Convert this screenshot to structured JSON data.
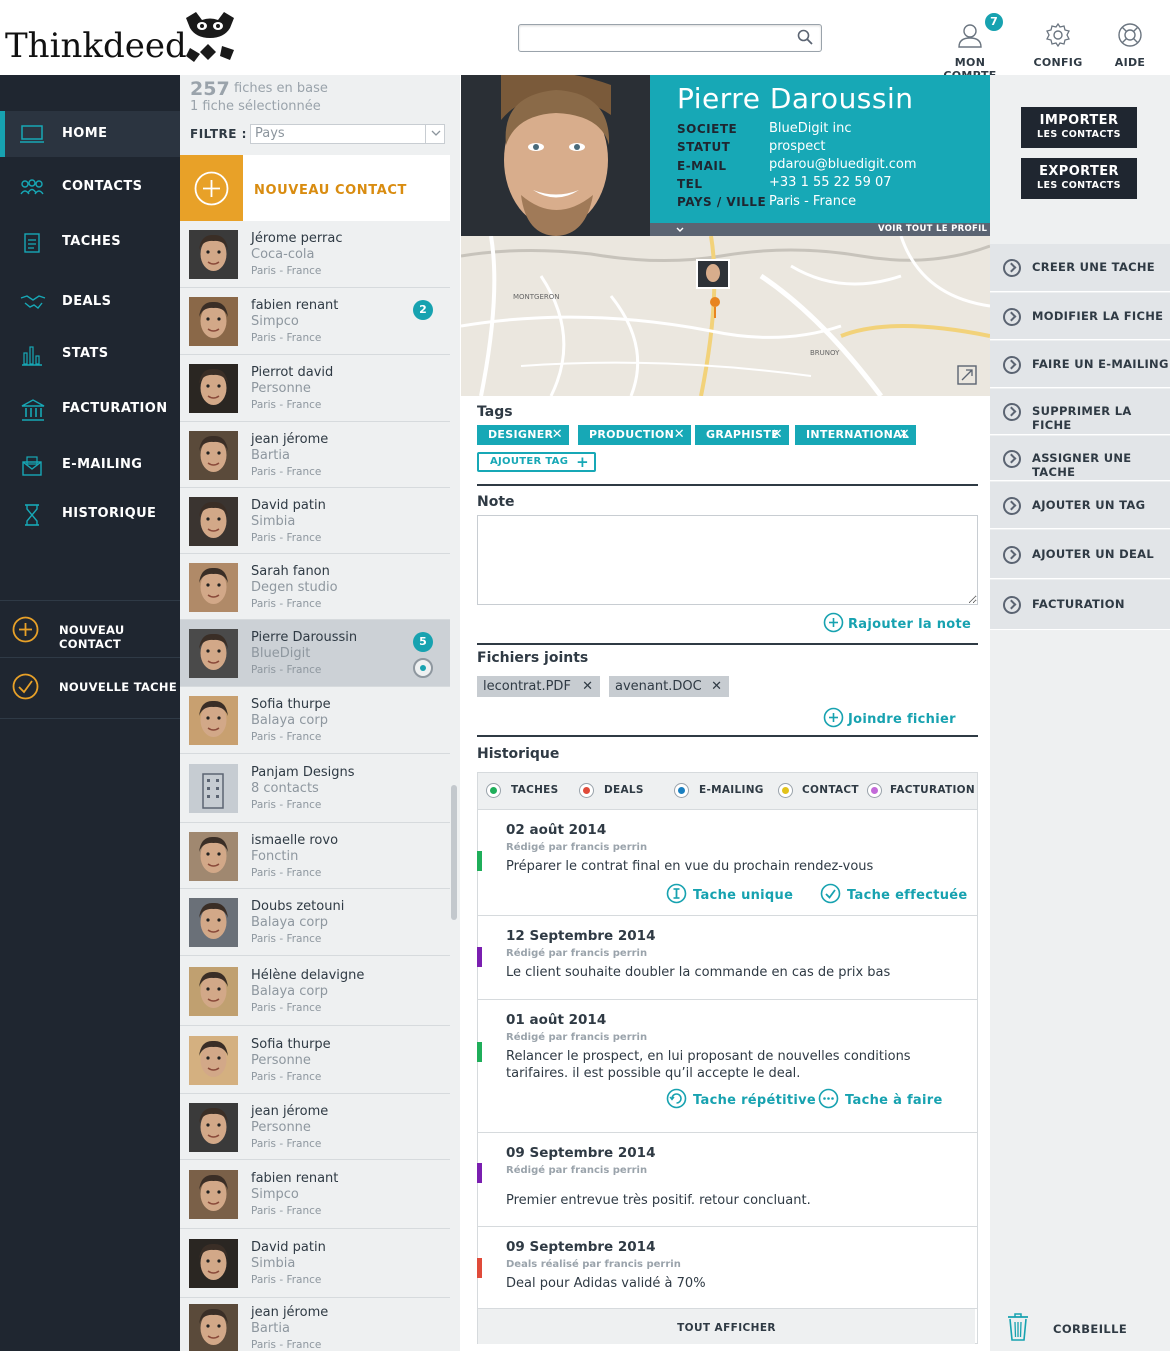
{
  "header": {
    "logo": "Thinkdeed",
    "search": {
      "placeholder": "",
      "value": ""
    },
    "nav": [
      {
        "label": "MON COMPTE",
        "icon": "user-icon",
        "badge": "7"
      },
      {
        "label": "CONFIG",
        "icon": "gear-icon"
      },
      {
        "label": "AIDE",
        "icon": "lifebuoy-icon"
      }
    ]
  },
  "sidebar": {
    "items": [
      {
        "label": "HOME",
        "icon": "monitor-icon",
        "active": true
      },
      {
        "label": "CONTACTS",
        "icon": "people-icon"
      },
      {
        "label": "TACHES",
        "icon": "clipboard-icon"
      },
      {
        "label": "DEALS",
        "icon": "handshake-icon"
      },
      {
        "label": "STATS",
        "icon": "bar-chart-icon"
      },
      {
        "label": "FACTURATION",
        "icon": "bank-icon"
      },
      {
        "label": "E-MAILING",
        "icon": "mail-icon"
      },
      {
        "label": "HISTORIQUE",
        "icon": "hourglass-icon"
      }
    ],
    "actions": [
      {
        "label": "NOUVEAU CONTACT",
        "icon": "plus-circle-icon"
      },
      {
        "label": "NOUVELLE TACHE",
        "icon": "check-circle-icon"
      }
    ]
  },
  "list": {
    "count": "257",
    "count_label": "fiches en base",
    "selected_label": "1 fiche sélectionnée",
    "filter_label": "FILTRE :",
    "filter_value": "Pays",
    "new_contact_label": "NOUVEAU CONTACT",
    "contacts": [
      {
        "name": "Jérome perrac",
        "company": "Coca-cola",
        "city": "Paris - France"
      },
      {
        "name": "fabien renant",
        "company": "Simpco",
        "city": "Paris - France",
        "badge": "2"
      },
      {
        "name": "Pierrot david",
        "company": "Personne",
        "city": "Paris - France"
      },
      {
        "name": "jean jérome",
        "company": "Bartia",
        "city": "Paris - France"
      },
      {
        "name": "David patin",
        "company": "Simbia",
        "city": "Paris - France"
      },
      {
        "name": "Sarah fanon",
        "company": "Degen studio",
        "city": "Paris - France"
      },
      {
        "name": "Pierre Daroussin",
        "company": "BlueDigit",
        "city": "Paris - France",
        "badge": "5",
        "selected": true
      },
      {
        "name": "Sofia thurpe",
        "company": "Balaya corp",
        "city": "Paris - France"
      },
      {
        "name": "Panjam Designs",
        "company": "8 contacts",
        "city": "Paris - France"
      },
      {
        "name": "ismaelle rovo",
        "company": "Fonctin",
        "city": "Paris - France"
      },
      {
        "name": "Doubs zetouni",
        "company": "Balaya corp",
        "city": "Paris - France"
      },
      {
        "name": "Hélène delavigne",
        "company": "Balaya corp",
        "city": "Paris - France"
      },
      {
        "name": "Sofia thurpe",
        "company": "Personne",
        "city": "Paris - France"
      },
      {
        "name": "jean jérome",
        "company": "Personne",
        "city": "Paris - France"
      },
      {
        "name": "fabien renant",
        "company": "Simpco",
        "city": "Paris - France"
      },
      {
        "name": "David patin",
        "company": "Simbia",
        "city": "Paris - France"
      },
      {
        "name": "jean jérome",
        "company": "Bartia",
        "city": "Paris - France"
      }
    ]
  },
  "profile": {
    "name": "Pierre Daroussin",
    "fields": [
      {
        "key": "SOCIETE",
        "value": "BlueDigit inc"
      },
      {
        "key": "STATUT",
        "value": "prospect"
      },
      {
        "key": "E-MAIL",
        "value": "pdarou@bluedigit.com"
      },
      {
        "key": "TEL",
        "value": "+33 1 55 22 59 07"
      },
      {
        "key": "PAYS / VILLE",
        "value": "Paris - France"
      }
    ],
    "voir_profil": "VOIR TOUT LE PROFIL",
    "map_labels": [
      "MONTGERON",
      "BRUNOY"
    ]
  },
  "tags": {
    "title": "Tags",
    "items": [
      "DESIGNER",
      "PRODUCTION",
      "GRAPHISTE",
      "INTERNATIONAL"
    ],
    "add_label": "AJOUTER TAG"
  },
  "note": {
    "title": "Note",
    "value": "",
    "add_label": "Rajouter la note"
  },
  "files": {
    "title": "Fichiers joints",
    "items": [
      "lecontrat.PDF",
      "avenant.DOC"
    ],
    "add_label": "Joindre fichier"
  },
  "history": {
    "title": "Historique",
    "filters": [
      {
        "label": "TACHES",
        "color": "#1fae5a"
      },
      {
        "label": "DEALS",
        "color": "#e04b3a"
      },
      {
        "label": "E-MAILING",
        "color": "#1a7fc0"
      },
      {
        "label": "CONTACT",
        "color": "#e2c21a"
      },
      {
        "label": "FACTURATION",
        "color": "#c36ad9"
      }
    ],
    "entries": [
      {
        "date": "02 août 2014",
        "by": "Rédigé par francis perrin",
        "text": "Préparer le contrat final en vue du prochain rendez-vous",
        "color": "#1fae5a",
        "tags": [
          "Tache unique",
          "Tache effectuée"
        ]
      },
      {
        "date": "12 Septembre 2014",
        "by": "Rédigé par francis perrin",
        "text": "Le client souhaite doubler la commande en cas de prix bas",
        "color": "#7a1fb0"
      },
      {
        "date": "01 août 2014",
        "by": "Rédigé par francis perrin",
        "text": "Relancer le prospect, en lui proposant de nouvelles conditions tarifaires. il est  possible qu’il accepte le deal.",
        "color": "#1fae5a",
        "tags": [
          "Tache répétitive",
          "Tache à faire"
        ]
      },
      {
        "date": "09 Septembre 2014",
        "by": "Rédigé par francis perrin",
        "text": "Premier entrevue très positif. retour concluant.",
        "color": "#7a1fb0"
      },
      {
        "date": "09 Septembre 2014",
        "by": "Deals réalisé par francis perrin",
        "text": "Deal pour Adidas validé à 70%",
        "color": "#e04b3a"
      }
    ],
    "show_all": "TOUT AFFICHER"
  },
  "right": {
    "import": {
      "l1": "IMPORTER",
      "l2": "LES CONTACTS"
    },
    "export": {
      "l1": "EXPORTER",
      "l2": "LES CONTACTS"
    },
    "actions": [
      "CREER UNE TACHE",
      "MODIFIER LA FICHE",
      "FAIRE UN E-MAILING",
      "SUPPRIMER LA FICHE",
      "ASSIGNER UNE TACHE",
      "AJOUTER UN TAG",
      "AJOUTER UN DEAL",
      "FACTURATION"
    ],
    "trash": "CORBEILLE"
  },
  "colors": {
    "accent": "#17a8b6",
    "orange": "#e8a128",
    "dark": "#1f2630"
  }
}
